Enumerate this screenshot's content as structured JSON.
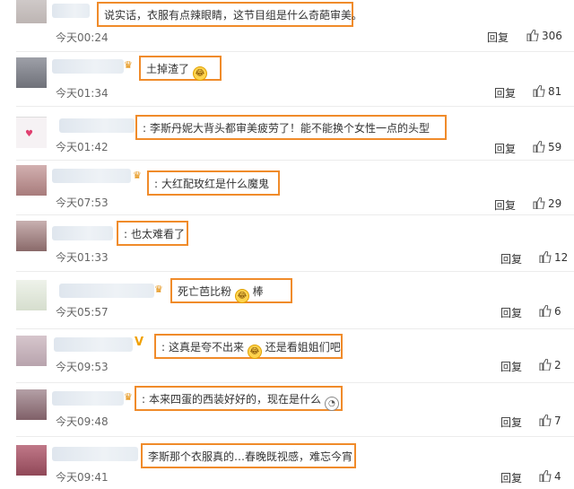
{
  "comments": [
    {
      "text": "说实话，衣服有点辣眼睛，这节目组是什么奇葩审美。",
      "time": "今天00:24",
      "reply": "回复",
      "likes": "306",
      "avatar_color": "#c7bfbd",
      "badge": "",
      "prefix": "",
      "emoji_mid": "",
      "suffix": "",
      "emoji_end": "",
      "colon": false
    },
    {
      "text": "土掉渣了",
      "time": "今天01:34",
      "reply": "回复",
      "likes": "81",
      "avatar_color": "#8c8e96",
      "badge": "crown",
      "prefix": "",
      "emoji_mid": "",
      "suffix": "",
      "emoji_end": "laugh-cry",
      "colon": false
    },
    {
      "text": "李斯丹妮大背头都审美疲劳了！能不能换个女性一点的头型",
      "time": "今天01:42",
      "reply": "回复",
      "likes": "59",
      "avatar_color": "#f2eef0",
      "badge": "",
      "prefix": "",
      "emoji_mid": "",
      "suffix": "",
      "emoji_end": "",
      "colon": true
    },
    {
      "text": "大红配玫红是什么魔鬼",
      "time": "今天07:53",
      "reply": "回复",
      "likes": "29",
      "avatar_color": "#b98c8c",
      "badge": "crown",
      "prefix": "",
      "emoji_mid": "",
      "suffix": "",
      "emoji_end": "",
      "colon": true
    },
    {
      "text": "也太难看了",
      "time": "今天01:33",
      "reply": "回复",
      "likes": "12",
      "avatar_color": "#a08a8a",
      "badge": "",
      "prefix": "",
      "emoji_mid": "",
      "suffix": "",
      "emoji_end": "",
      "colon": false
    },
    {
      "text": "死亡芭比粉",
      "time": "今天05:57",
      "reply": "回复",
      "likes": "6",
      "avatar_color": "#dde6d6",
      "badge": "crown",
      "prefix": "",
      "emoji_mid": "laugh-cry",
      "suffix": "棒",
      "emoji_end": "",
      "colon": false
    },
    {
      "text": "这真是夸不出来",
      "time": "今天09:53",
      "reply": "回复",
      "likes": "2",
      "avatar_color": "#c9b7bf",
      "badge": "v",
      "prefix": "",
      "emoji_mid": "laugh-cry",
      "suffix": "还是看姐姐们吧",
      "emoji_end": "",
      "colon": true
    },
    {
      "text": "本来四蛋的西装好好的，现在是什么",
      "time": "今天09:48",
      "reply": "回复",
      "likes": "7",
      "avatar_color": "#9a8088",
      "badge": "crown",
      "prefix": "",
      "emoji_mid": "",
      "suffix": "",
      "emoji_end": "confused",
      "colon": true
    },
    {
      "text": "李斯那个衣服真的…春晚既视感，难忘今宵",
      "time": "今天09:41",
      "reply": "回复",
      "likes": "4",
      "avatar_color": "#b06878",
      "badge": "",
      "prefix": "",
      "emoji_mid": "",
      "suffix": "",
      "emoji_end": "",
      "colon": false
    }
  ]
}
